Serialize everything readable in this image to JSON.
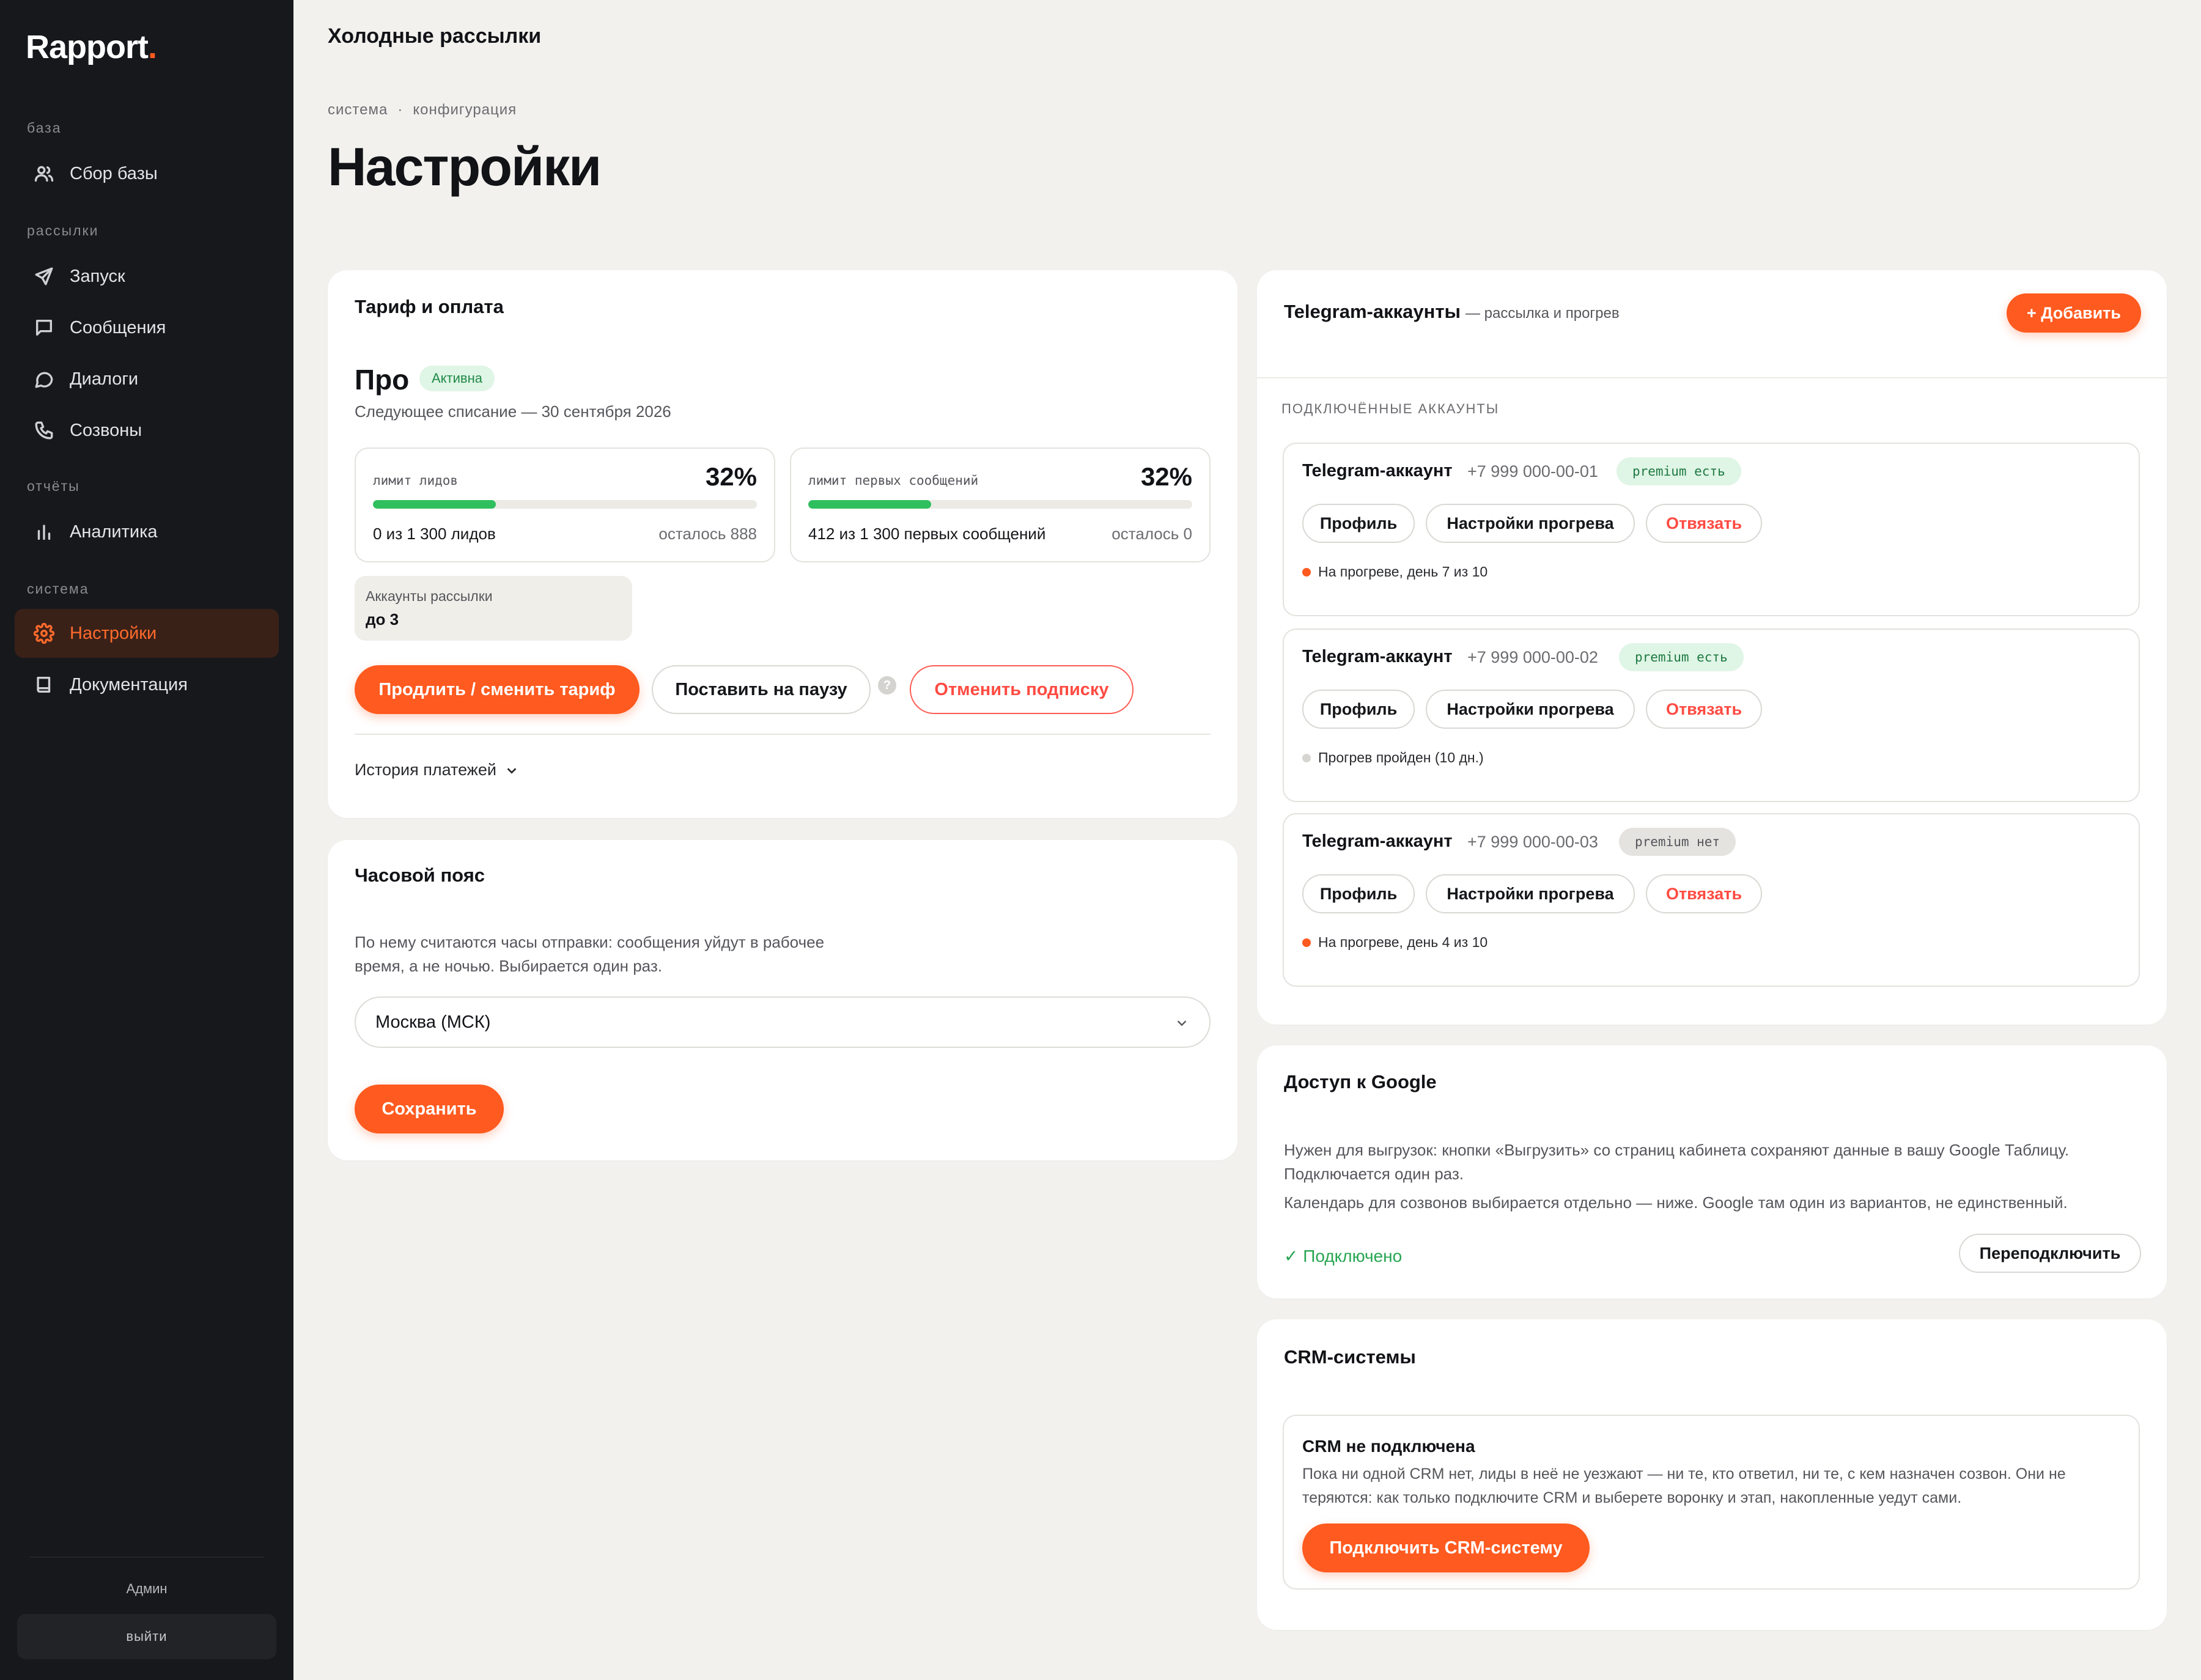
{
  "sidebar": {
    "logo": "Rapport",
    "logo_dot": ".",
    "sections": {
      "base": "база",
      "mailings": "рассылки",
      "reports": "отчёты",
      "system": "система"
    },
    "items": [
      {
        "label": "Сбор базы",
        "icon": "users-icon"
      },
      {
        "label": "Запуск",
        "icon": "send-icon"
      },
      {
        "label": "Сообщения",
        "icon": "message-square-icon"
      },
      {
        "label": "Диалоги",
        "icon": "message-circle-icon"
      },
      {
        "label": "Созвоны",
        "icon": "phone-icon"
      },
      {
        "label": "Аналитика",
        "icon": "bar-chart-icon"
      },
      {
        "label": "Настройки",
        "icon": "gear-icon",
        "active": true
      },
      {
        "label": "Документация",
        "icon": "book-icon"
      }
    ],
    "user": "Админ",
    "logout": "выйти"
  },
  "header": {
    "title": "Холодные рассылки",
    "breadcrumb": [
      "система",
      "·",
      "конфигурация"
    ],
    "page_title": "Настройки"
  },
  "tariff": {
    "title": "Тариф и оплата",
    "plan": "Про",
    "status": "Активна",
    "next_charge": "Следующее списание — 30 сентября 2026",
    "limits": [
      {
        "label": "лимит лидов",
        "percent": "32%",
        "fill": 0.32,
        "used": "0 из 1 300 лидов",
        "left": "осталось 888"
      },
      {
        "label": "лимит первых сообщений",
        "percent": "32%",
        "fill": 0.32,
        "used": "412 из 1 300 первых сообщений",
        "left": "осталось 0"
      }
    ],
    "accounts_label": "Аккаунты рассылки",
    "accounts_value": "до 3",
    "renew_button": "Продлить / сменить тариф",
    "pause_button": "Поставить на паузу",
    "help": "?",
    "cancel_button": "Отменить подписку",
    "history": "История платежей"
  },
  "timezone": {
    "title": "Часовой пояс",
    "description": "По нему считаются часы отправки: сообщения уйдут в рабочее время, а не ночью. Выбирается один раз.",
    "selected": "Москва (МСК)",
    "save_button": "Сохранить"
  },
  "telegram": {
    "title": "Telegram-аккаунты",
    "subtitle": "— рассылка и прогрев",
    "add_button": "+ Добавить",
    "section_caption": "ПОДКЛЮЧЁННЫЕ АККАУНТЫ",
    "accounts": [
      {
        "name": "Telegram-аккаунт",
        "phone": "+7 999 000-00-01",
        "premium": "premium есть",
        "premium_state": "yes",
        "status": "На прогреве, день 7 из 10",
        "status_color": "#ff5a1f"
      },
      {
        "name": "Telegram-аккаунт",
        "phone": "+7 999 000-00-02",
        "premium": "premium есть",
        "premium_state": "yes",
        "status": "Прогрев пройден (10 дн.)",
        "status_color": "#d6d5d1"
      },
      {
        "name": "Telegram-аккаунт",
        "phone": "+7 999 000-00-03",
        "premium": "premium нет",
        "premium_state": "no",
        "status": "На прогреве, день 4 из 10",
        "status_color": "#ff5a1f"
      }
    ],
    "profile_button": "Профиль",
    "warmup_button": "Настройки прогрева",
    "unlink_button": "Отвязать"
  },
  "google": {
    "title": "Доступ к Google",
    "description_1": "Нужен для выгрузок: кнопки «Выгрузить» со страниц кабинета сохраняют данные в вашу Google Таблицу. Подключается один раз.",
    "description_2": "Календарь для созвонов выбирается отдельно — ниже. Google там один из вариантов, не единственный.",
    "status": "✓ Подключено",
    "reconnect_button": "Переподключить"
  },
  "crm": {
    "title": "CRM-системы",
    "box_title": "CRM не подключена",
    "description": "Пока ни одной CRM нет, лиды в неё не уезжают — ни те, кто ответил, ни те, с кем назначен созвон. Они не теряются: как только подключите CRM и выберете воронку и этап, накопленные уедут сами.",
    "connect_button": "Подключить CRM-систему"
  },
  "colors": {
    "accent": "#ff5a1f",
    "sidebar_bg": "#17181c",
    "page_bg": "#f2f1ee",
    "success": "#2fbf5e",
    "danger": "#ff4b42"
  }
}
